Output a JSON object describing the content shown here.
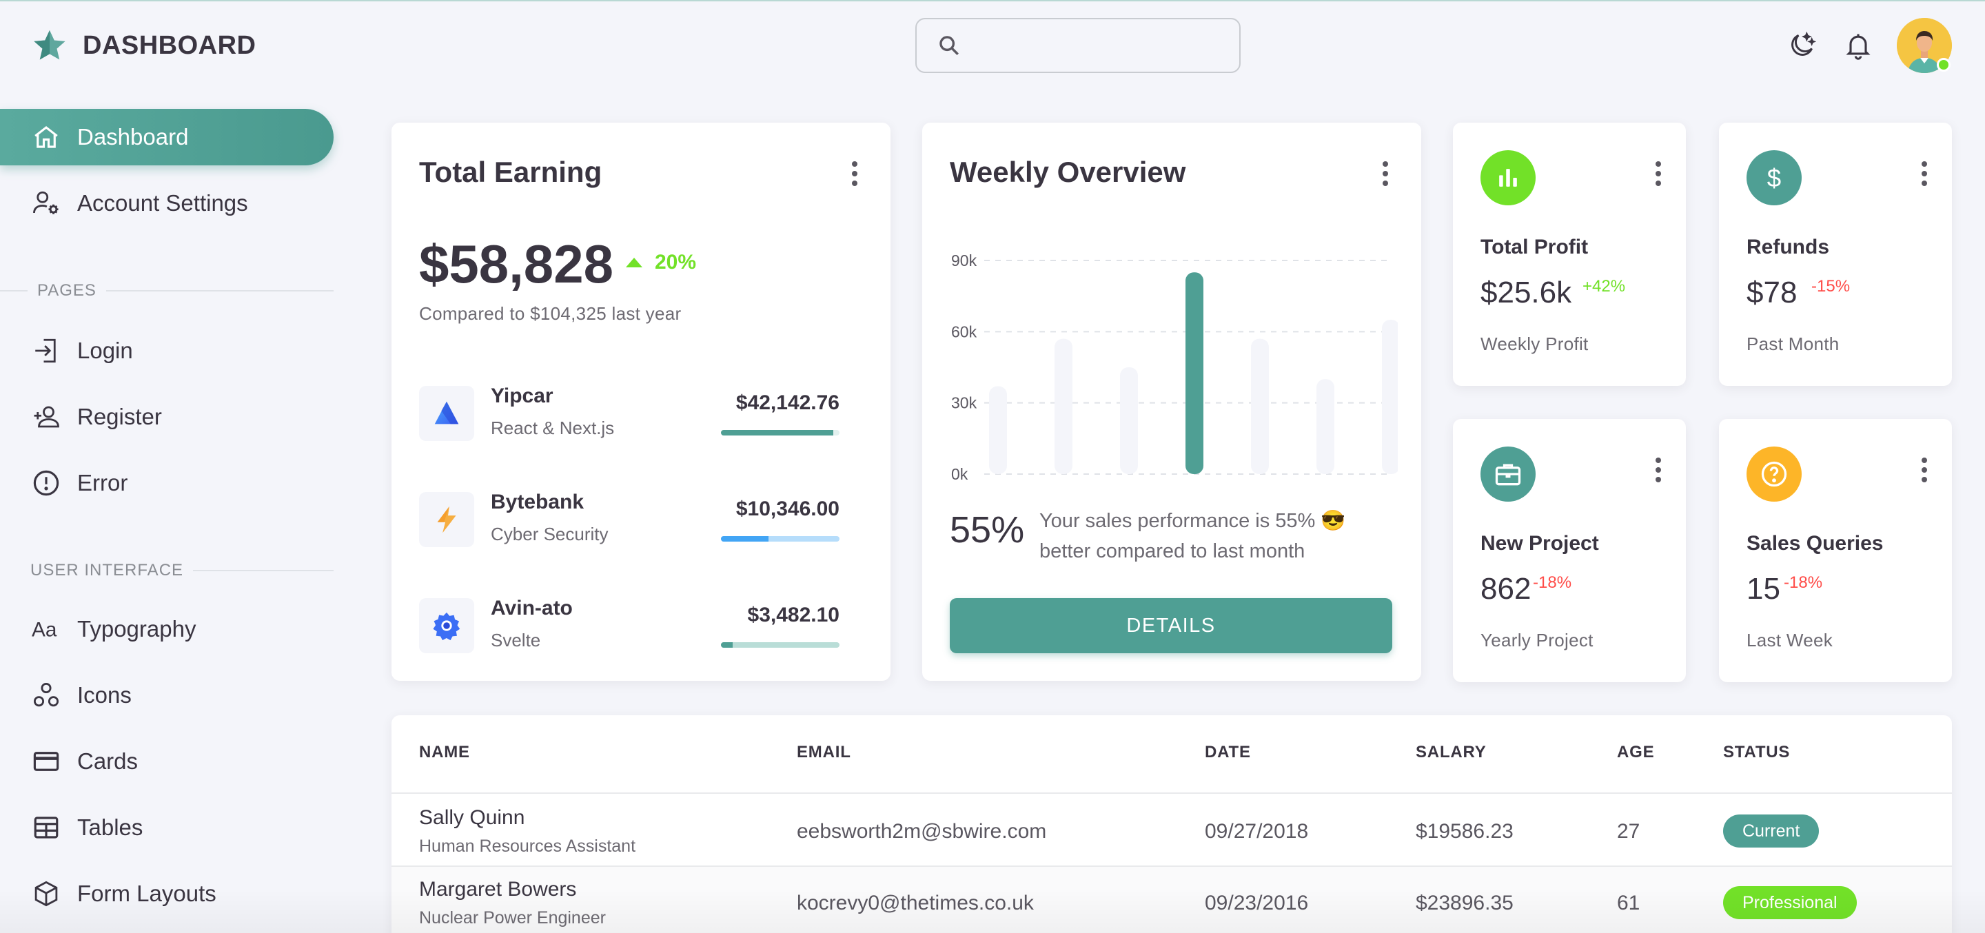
{
  "brand": {
    "title": "DASHBOARD",
    "icon": "star-icon",
    "accent": "#4f9f94"
  },
  "header": {
    "search": {
      "value": "",
      "placeholder": ""
    },
    "icons": [
      "moon-icon",
      "bell-icon"
    ]
  },
  "sidebar": {
    "items": [
      {
        "label": "Dashboard",
        "icon": "home-icon",
        "active": true
      },
      {
        "label": "Account Settings",
        "icon": "account-cog-icon"
      }
    ],
    "pages_title": "PAGES",
    "pages": [
      {
        "label": "Login",
        "icon": "login-icon"
      },
      {
        "label": "Register",
        "icon": "add-user-icon"
      },
      {
        "label": "Error",
        "icon": "alert-circle-icon"
      }
    ],
    "ui_title": "USER INTERFACE",
    "ui": [
      {
        "label": "Typography",
        "icon": "typography-icon"
      },
      {
        "label": "Icons",
        "icon": "shapes-icon"
      },
      {
        "label": "Cards",
        "icon": "credit-card-icon"
      },
      {
        "label": "Tables",
        "icon": "table-icon"
      },
      {
        "label": "Form Layouts",
        "icon": "cube-icon"
      }
    ]
  },
  "total_earning": {
    "title": "Total Earning",
    "amount": "$58,828",
    "change": "20%",
    "compare": "Compared to $104,325 last year",
    "projects": [
      {
        "name": "Yipcar",
        "sub": "React & Next.js",
        "amount": "$42,142.76",
        "progress": 0.95,
        "color": "#4f9f94",
        "track": "#e3f1ef",
        "icon": "yipcar-logo-icon"
      },
      {
        "name": "Bytebank",
        "sub": "Cyber Security",
        "amount": "$10,346.00",
        "progress": 0.4,
        "color": "#42a5f5",
        "track": "#b6ddfb",
        "icon": "bolt-logo-icon"
      },
      {
        "name": "Avin-ato",
        "sub": "Svelte",
        "amount": "$3,482.10",
        "progress": 0.1,
        "color": "#4f9f94",
        "track": "#b9ddd7",
        "icon": "gear-logo-icon"
      }
    ]
  },
  "weekly": {
    "title": "Weekly Overview",
    "percent": "55%",
    "text": "Your sales performance is 55% 😎 better compared to last month",
    "button": "DETAILS"
  },
  "chart_data": {
    "type": "bar",
    "categories": [
      "",
      "",
      "",
      "",
      "",
      "",
      ""
    ],
    "values": [
      37,
      57,
      45,
      85,
      57,
      40,
      65
    ],
    "highlight_index": 3,
    "yticks": [
      "90k",
      "60k",
      "30k",
      "0k"
    ],
    "ylim": [
      0,
      90
    ],
    "title": "",
    "xlabel": "",
    "ylabel": "",
    "grid": true
  },
  "stats": [
    {
      "title": "Total Profit",
      "value": "$25.6k",
      "change": "+42%",
      "sub": "Weekly Profit",
      "icon": "poll-icon",
      "color": "#72e128",
      "change_color": "#72e128"
    },
    {
      "title": "Refunds",
      "value": "$78",
      "change": "-15%",
      "sub": "Past Month",
      "icon": "dollar-icon",
      "color": "#4f9f94",
      "change_color": "#ff4d49"
    },
    {
      "title": "New Project",
      "value": "862",
      "change": "-18%",
      "sub": "Yearly Project",
      "icon": "briefcase-icon",
      "color": "#4f9f94",
      "change_color": "#ff4d49"
    },
    {
      "title": "Sales Queries",
      "value": "15",
      "change": "-18%",
      "sub": "Last Week",
      "icon": "help-circle-icon",
      "color": "#fdb528",
      "change_color": "#ff4d49"
    }
  ],
  "table": {
    "headers": [
      "NAME",
      "EMAIL",
      "DATE",
      "SALARY",
      "AGE",
      "STATUS"
    ],
    "rows": [
      {
        "name": "Sally Quinn",
        "role": "Human Resources Assistant",
        "email": "eebsworth2m@sbwire.com",
        "date": "09/27/2018",
        "salary": "$19586.23",
        "age": "27",
        "status": "Current",
        "status_color": "#4f9f94"
      },
      {
        "name": "Margaret Bowers",
        "role": "Nuclear Power Engineer",
        "email": "kocrevy0@thetimes.co.uk",
        "date": "09/23/2016",
        "salary": "$23896.35",
        "age": "61",
        "status": "Professional",
        "status_color": "#72e128"
      }
    ]
  }
}
